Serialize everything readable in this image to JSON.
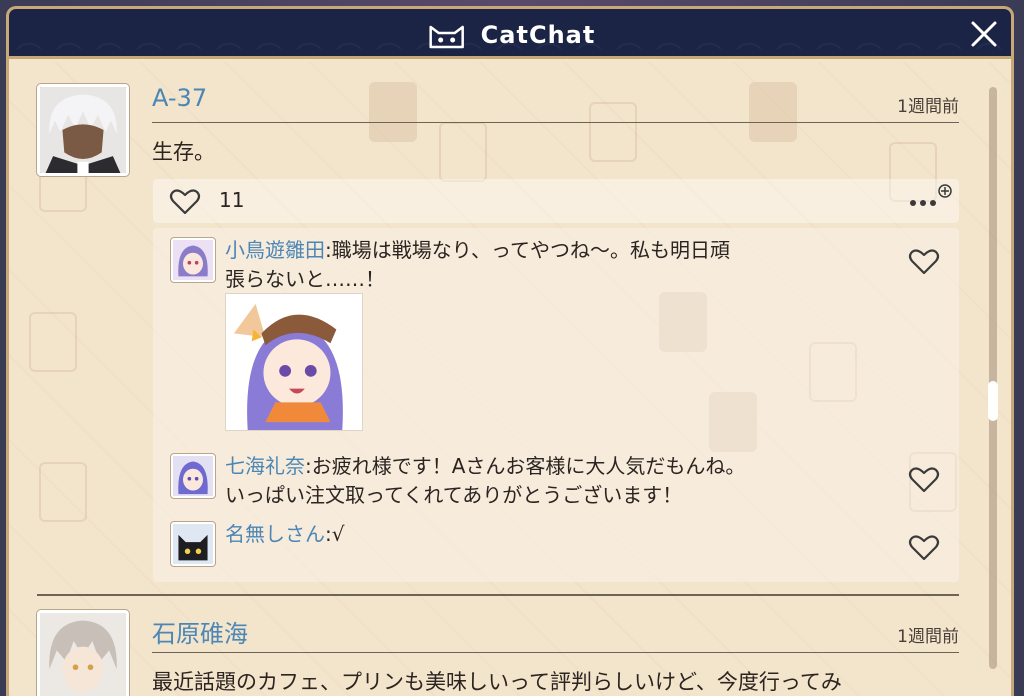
{
  "app": {
    "title": "CatChat"
  },
  "colors": {
    "titlebar": "#1c2446",
    "username": "#4b86b5",
    "frame": "#c9a878",
    "panel": "#f3e4cc"
  },
  "icons": {
    "title": "cat-face-icon",
    "close": "close-icon",
    "like": "heart-icon",
    "more": "more-options-icon"
  },
  "posts": [
    {
      "username": "A-37",
      "time": "1週間前",
      "text": "生存。",
      "likes": "11",
      "comments": [
        {
          "name": "小鳥遊雛田",
          "separator": ":",
          "line1": "職場は戦場なり、ってやつね～。私も明日頑",
          "line2": "張らないと……！",
          "has_sticker": true
        },
        {
          "name": "七海礼奈",
          "separator": ":",
          "line1": "お疲れ様です！Aさんお客様に大人気だもんね。",
          "line2": "いっぱい注文取ってくれてありがとうございます！"
        },
        {
          "name": "名無しさん",
          "separator": ":",
          "line1": "√",
          "line2": ""
        }
      ]
    },
    {
      "username": "石原碓海",
      "time": "1週間前",
      "text": "最近話題のカフェ、プリンも美味しいって評判らしいけど、今度行ってみ"
    }
  ]
}
